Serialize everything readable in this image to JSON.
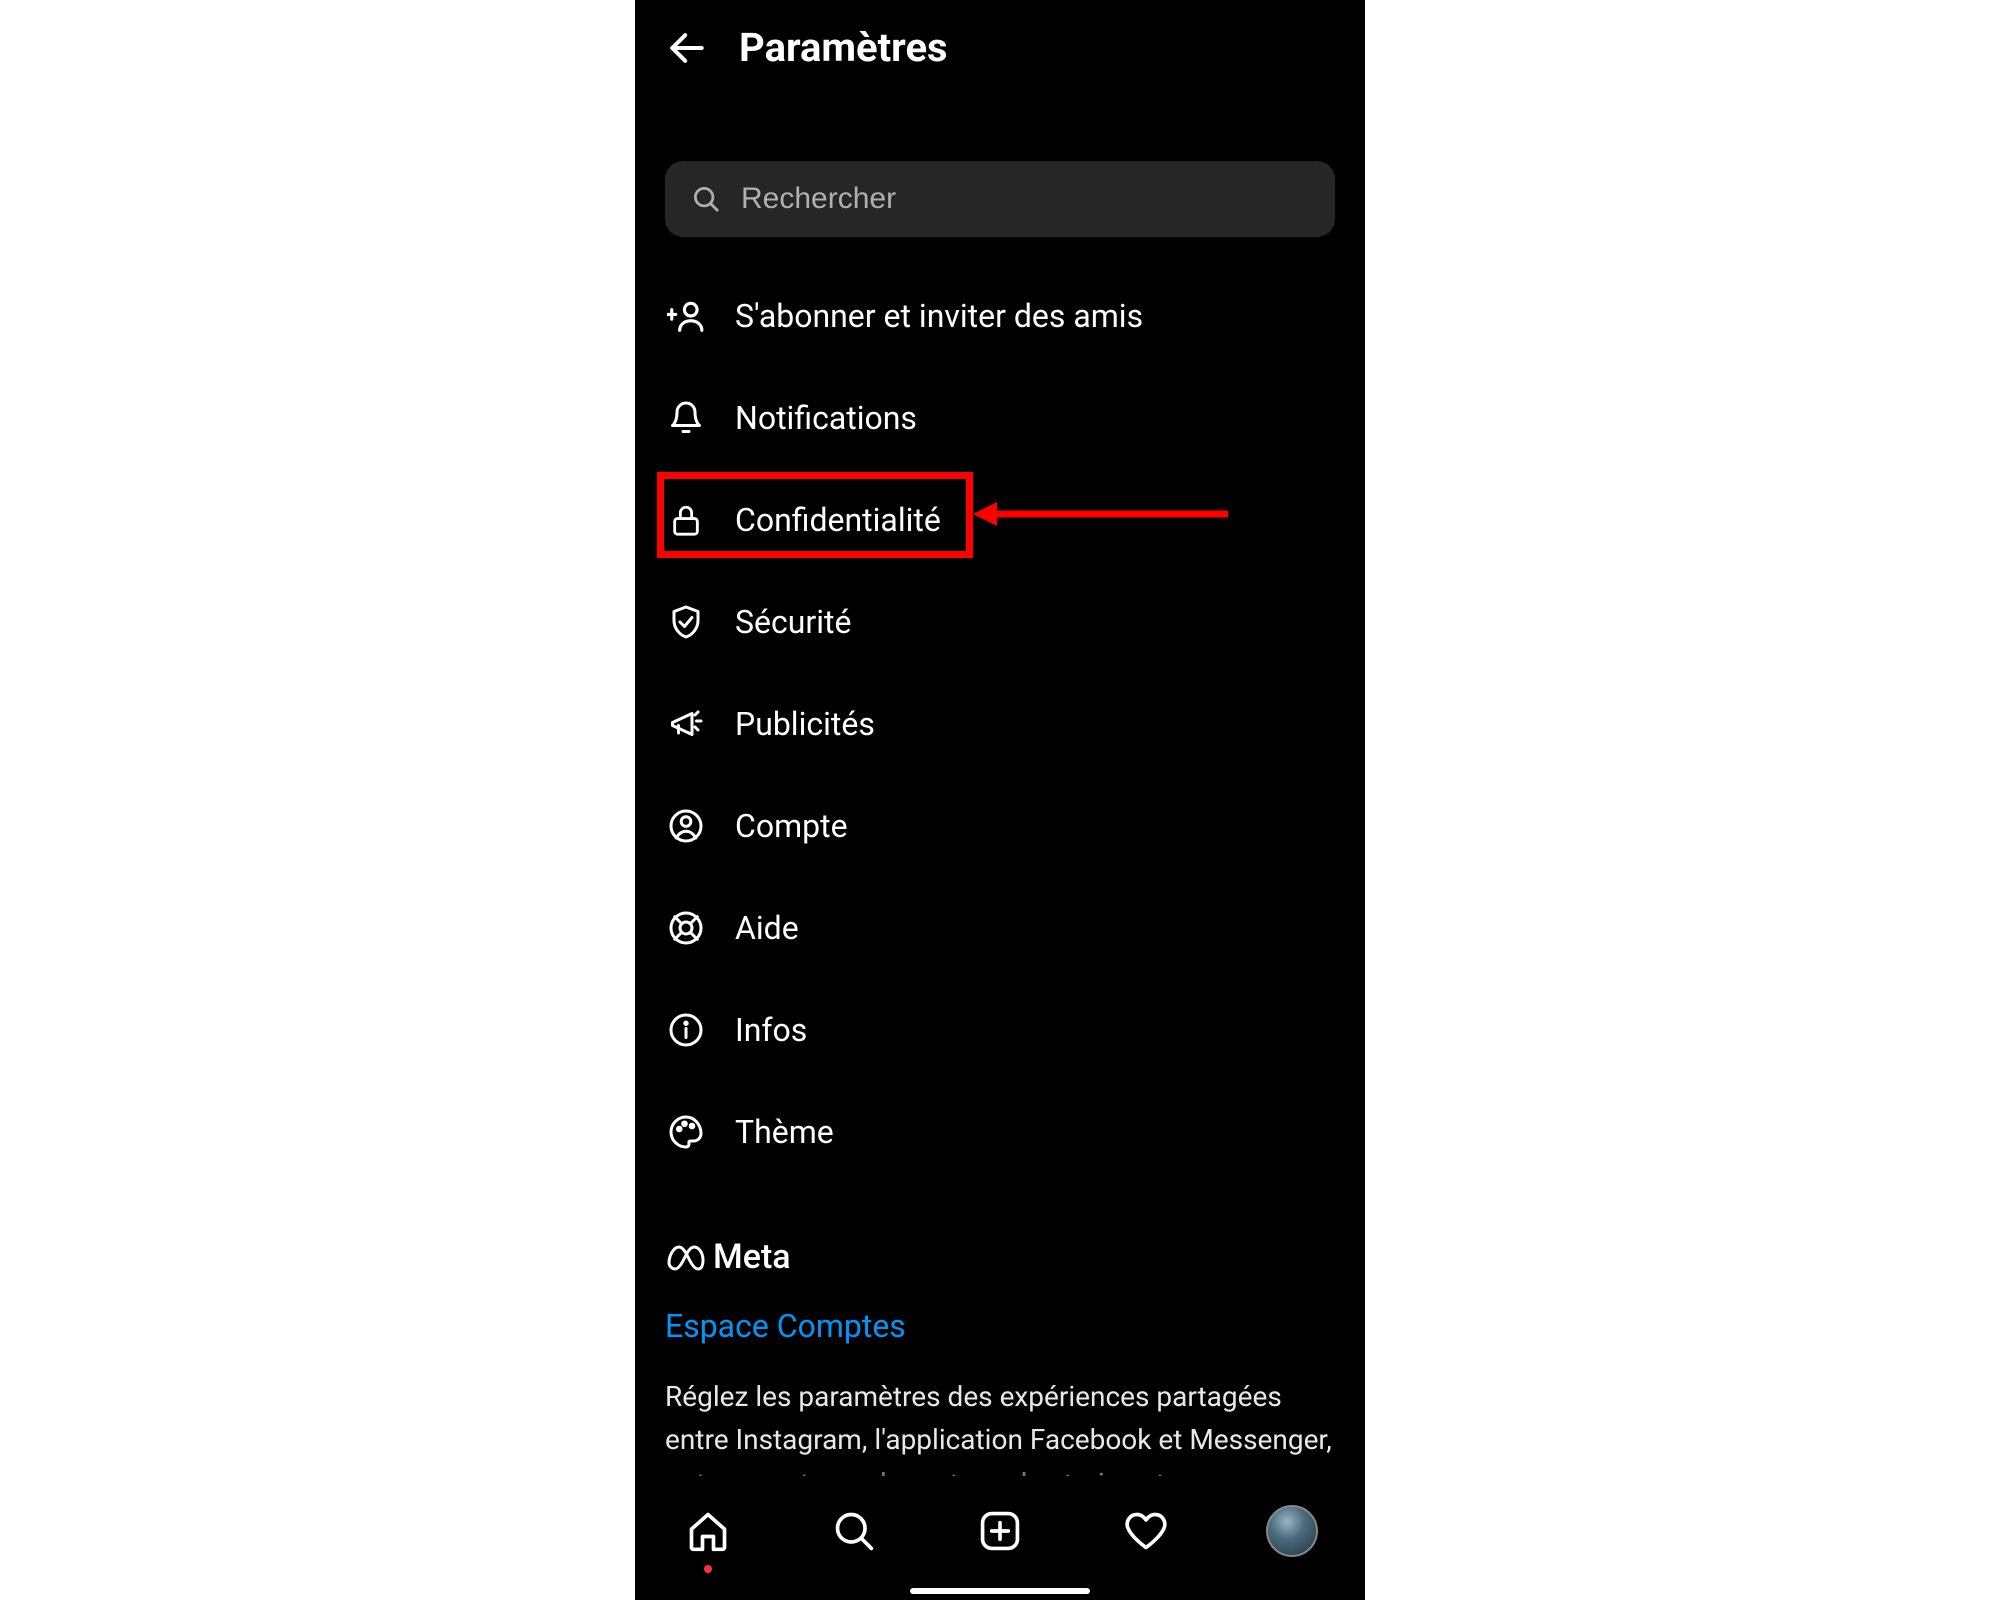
{
  "header": {
    "title": "Paramètres"
  },
  "search": {
    "placeholder": "Rechercher"
  },
  "items": [
    {
      "label": "S'abonner et inviter des amis",
      "icon": "add-person-icon"
    },
    {
      "label": "Notifications",
      "icon": "bell-icon"
    },
    {
      "label": "Confidentialité",
      "icon": "lock-icon"
    },
    {
      "label": "Sécurité",
      "icon": "shield-icon"
    },
    {
      "label": "Publicités",
      "icon": "megaphone-icon"
    },
    {
      "label": "Compte",
      "icon": "user-circle-icon"
    },
    {
      "label": "Aide",
      "icon": "lifebuoy-icon"
    },
    {
      "label": "Infos",
      "icon": "info-icon"
    },
    {
      "label": "Thème",
      "icon": "palette-icon"
    }
  ],
  "meta": {
    "brand": "Meta",
    "accounts_link": "Espace Comptes",
    "description": "Réglez les paramètres des expériences partagées entre Instagram, l'application Facebook et Messenger, notamment pour le partage de stories et"
  },
  "highlight": {
    "target_item_index": 2
  }
}
